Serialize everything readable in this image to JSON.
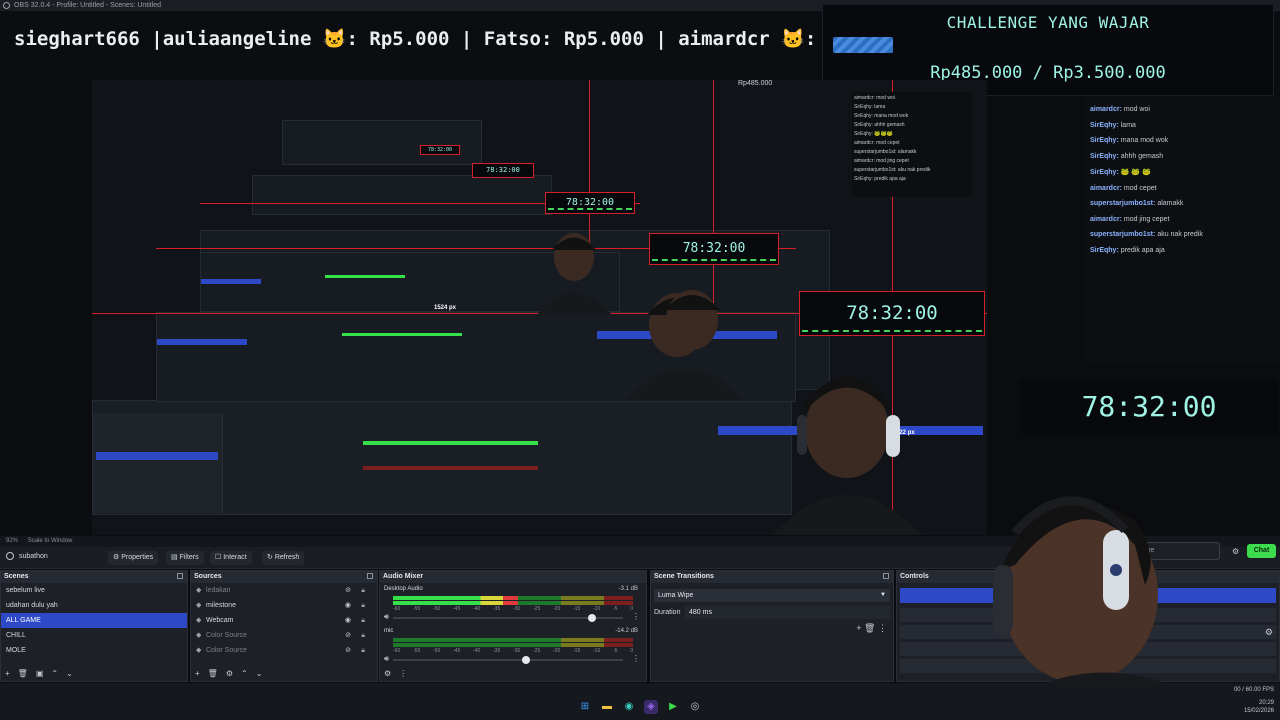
{
  "window": {
    "title": "OBS 32.0.4 - Profile: Untitled - Scenes: Untitled"
  },
  "ticker": {
    "text": "sieghart666 |auliaangeline 🐱: Rp5.000 | Fatso: Rp5.000 | aimardcr 🐱: Rp"
  },
  "challenge": {
    "title": "CHALLENGE YANG WAJAR",
    "amount": "Rp485.000 / Rp3.500.000",
    "progress_fraction": 0.1386
  },
  "preview": {
    "timer": "78:32:00",
    "dimension_label_1": "1524 px",
    "dimension_label_2": "422 px",
    "nested_amount": "Rp485.000"
  },
  "chat": {
    "messages": [
      {
        "user": "aimardcr:",
        "text": "mod woi"
      },
      {
        "user": "SirEqhy:",
        "text": "lama"
      },
      {
        "user": "SirEqhy:",
        "text": "mana mod wok"
      },
      {
        "user": "SirEqhy:",
        "text": "ahhh gemash"
      },
      {
        "user": "SirEqhy:",
        "text": "🐸 🐸 🐸"
      },
      {
        "user": "aimardcr:",
        "text": "mod cepet"
      },
      {
        "user": "superstarjumbo1st:",
        "text": "alamakk"
      },
      {
        "user": "aimardcr:",
        "text": "mod jing cepet"
      },
      {
        "user": "superstarjumbo1st:",
        "text": "aku nak predik"
      },
      {
        "user": "SirEqhy:",
        "text": "predik apa aja"
      }
    ],
    "input_placeholder": "message",
    "send_label": "Chat"
  },
  "big_timer": "78:32:00",
  "zoom": {
    "percent": "92%",
    "mode": "Scale to Window"
  },
  "toolbar": {
    "scene_name": "subathon",
    "properties": "Properties",
    "filters": "Filters",
    "interact": "Interact",
    "refresh": "Refresh"
  },
  "scenes": {
    "title": "Scenes",
    "items": [
      "sebelum live",
      "udahan dulu yah",
      "ALL GAME",
      "CHILL",
      "MOLE"
    ],
    "selected": "ALL GAME"
  },
  "sources": {
    "title": "Sources",
    "items": [
      {
        "name": "ledakan",
        "visible": false
      },
      {
        "name": "milestone",
        "visible": true
      },
      {
        "name": "Webcam",
        "visible": true
      },
      {
        "name": "Color Source",
        "visible": false
      },
      {
        "name": "Color Source",
        "visible": false
      }
    ]
  },
  "audio": {
    "title": "Audio Mixer",
    "channels": [
      {
        "name": "Desktop Audio",
        "db": "-3.1 dB",
        "level": 0.52,
        "volume": 0.88
      },
      {
        "name": "mic",
        "db": "-14.2 dB",
        "level": 0.0,
        "volume": 0.58
      }
    ],
    "ticks": [
      "-60",
      "-55",
      "-50",
      "-45",
      "-40",
      "-35",
      "-30",
      "-25",
      "-20",
      "-15",
      "-10",
      "-5",
      "0"
    ]
  },
  "transitions": {
    "title": "Scene Transitions",
    "selected": "Luma Wipe",
    "duration_label": "Duration",
    "duration": "480 ms"
  },
  "controls": {
    "title": "Controls"
  },
  "status": {
    "fps": "00 / 60.00 FPS",
    "time": "20:29",
    "date": "15/02/2026"
  },
  "colors": {
    "accent": "#2d49c7",
    "timer_text": "#9ff3e4",
    "guide_red": "#d51f2a",
    "chat_green": "#3ddc4d"
  }
}
